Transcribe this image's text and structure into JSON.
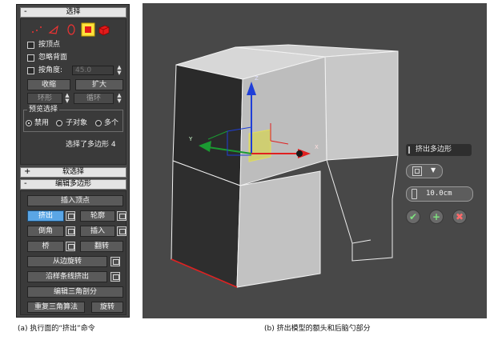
{
  "left_panel": {
    "selection": {
      "header": "选择",
      "sign": "-",
      "options": [
        "按顶点",
        "忽略背面",
        "按角度:"
      ],
      "angle_value": "45.0",
      "buttons": [
        "收缩",
        "扩大",
        "环形",
        "循环"
      ],
      "preview_group": "预览选择",
      "preview_options": [
        "禁用",
        "子对象",
        "多个"
      ],
      "status": "选择了多边形 4",
      "subobject_colors": {
        "polygon": "#e21b1b",
        "element": "#e21b1b",
        "highlight": "#ffe23d"
      }
    },
    "soft_selection": {
      "header": "软选择",
      "sign": "+"
    },
    "edit_polygons": {
      "header": "编辑多边形",
      "sign": "-",
      "insert_vertex": "插入顶点",
      "extrude": "挤出",
      "outline": "轮廓",
      "bevel": "倒角",
      "inset": "插入",
      "flip_left": "桥",
      "flip": "翻转",
      "hinge": "从边旋转",
      "extrude_spline": "沿样条线挤出",
      "edit_triangulation": "编辑三角剖分",
      "retriangulate": "重复三角算法",
      "turn": "旋转"
    }
  },
  "viewport": {
    "gizmo_axes": {
      "x": "X",
      "y": "Y",
      "z": "Z"
    },
    "colors": {
      "x_axis": "#e02020",
      "y_axis": "#1b9a32",
      "z_axis": "#1f3fd8",
      "face_selected": "#d6d45a"
    },
    "caddy": {
      "title": "挤出多边形",
      "type_dropdown_icon": "group-extrude-icon",
      "height_value": "10.0cm",
      "ok_icon": "check-icon",
      "apply_icon": "plus-icon",
      "cancel_icon": "close-icon"
    }
  },
  "captions": {
    "a": "(a) 执行面的“挤出”命令",
    "b": "(b) 挤出模型的额头和后脑勺部分"
  }
}
